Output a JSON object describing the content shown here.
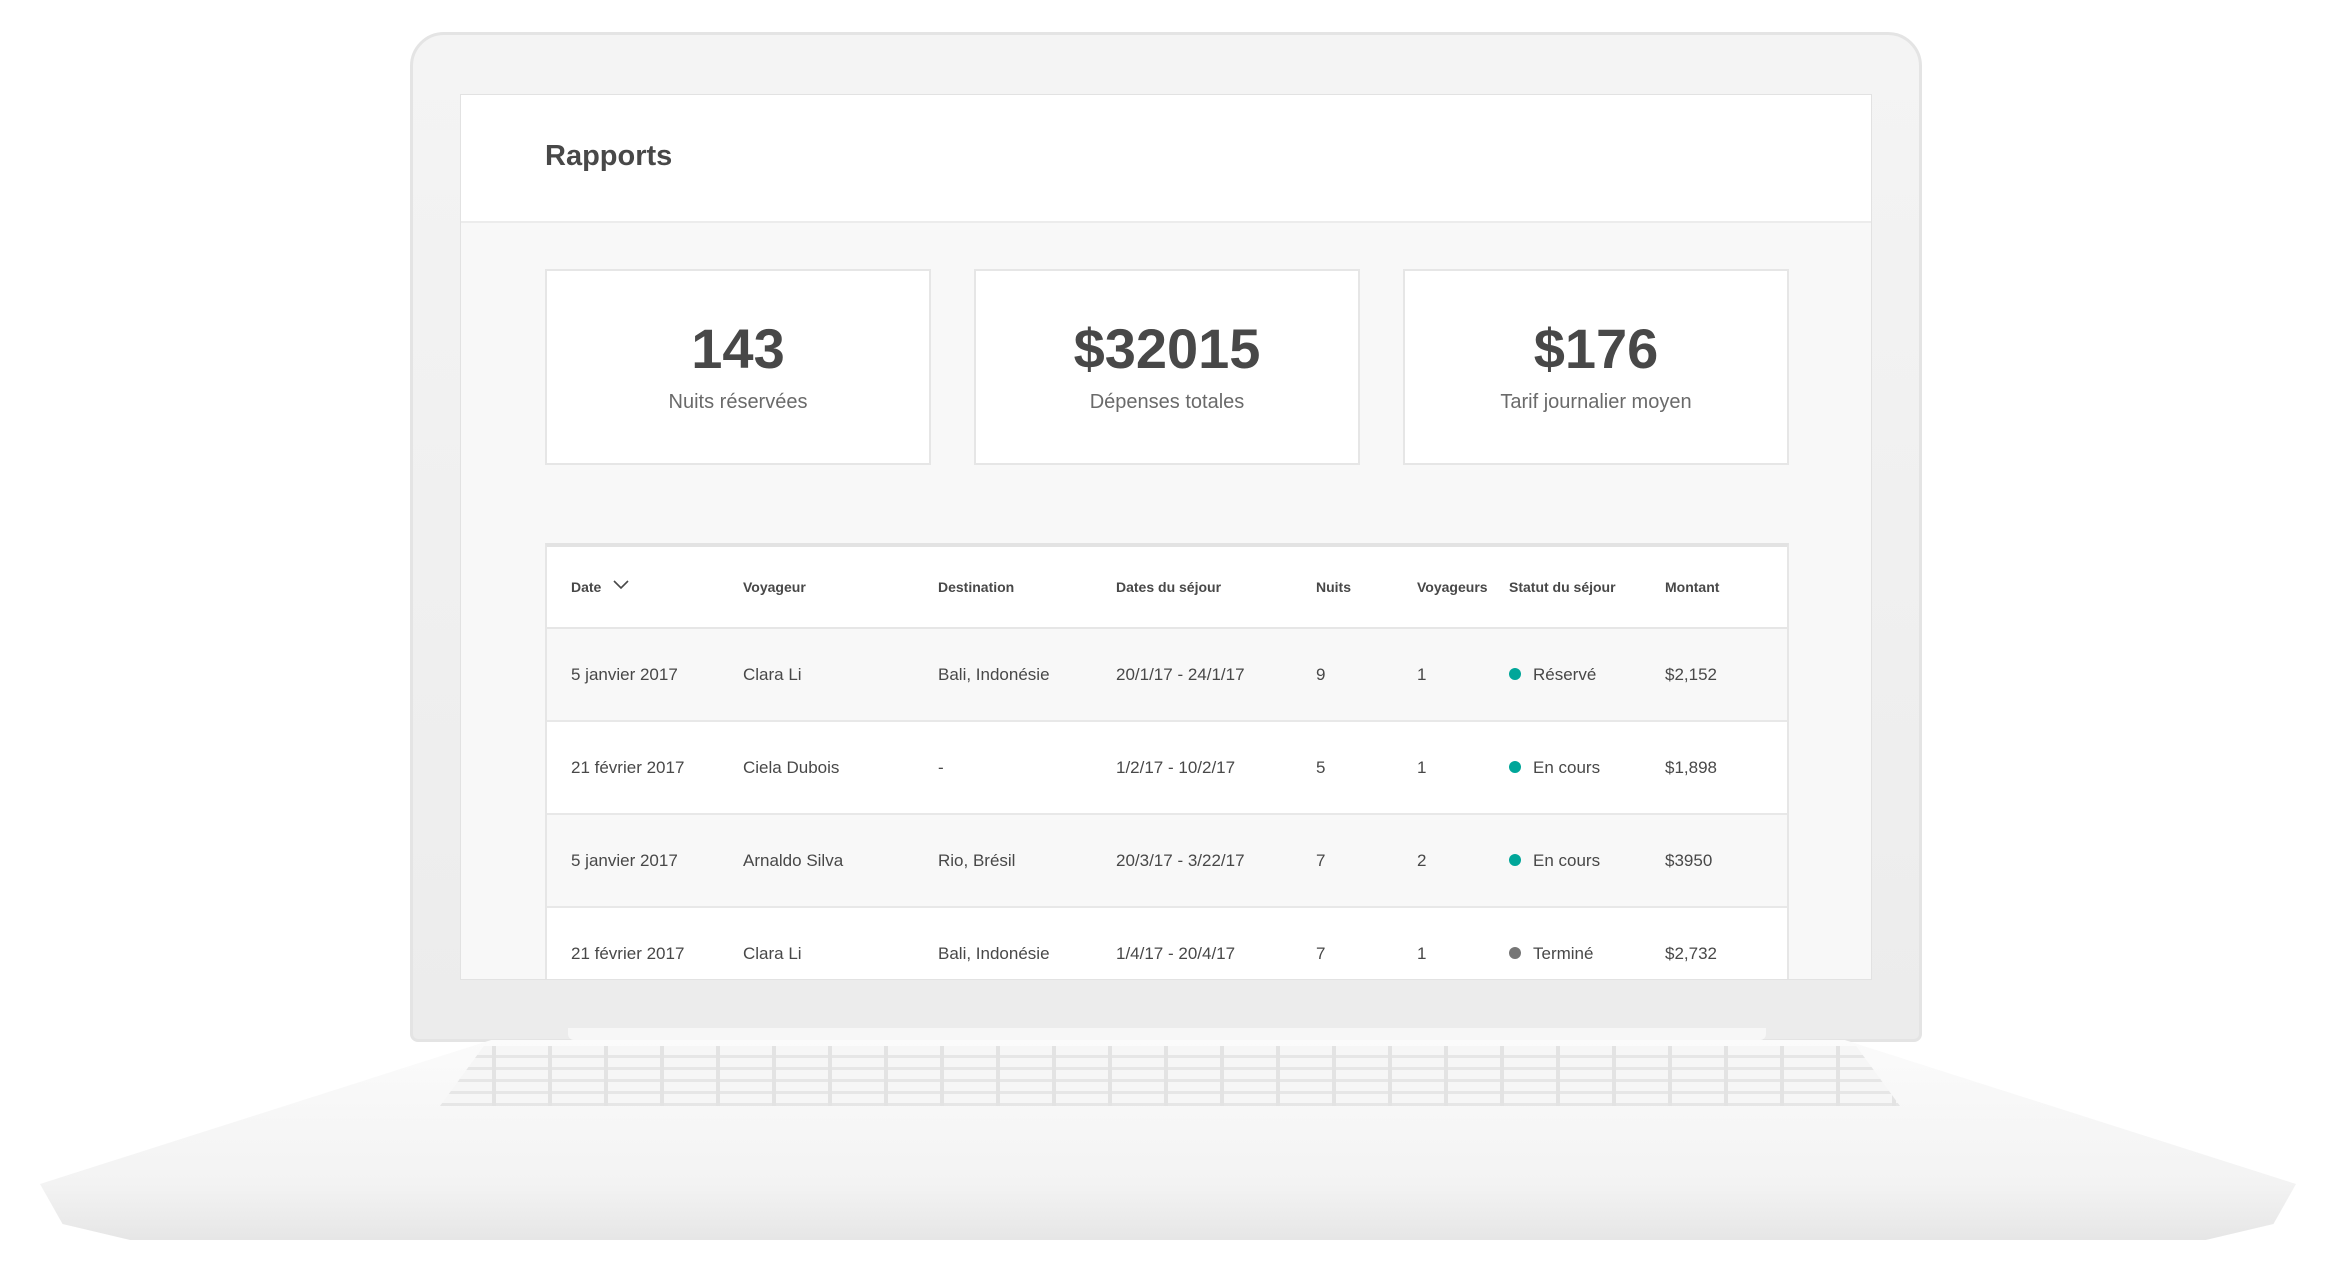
{
  "header": {
    "title": "Rapports"
  },
  "stats": [
    {
      "value": "143",
      "label": "Nuits réservées"
    },
    {
      "value": "$32015",
      "label": "Dépenses totales"
    },
    {
      "value": "$176",
      "label": "Tarif journalier moyen"
    }
  ],
  "table": {
    "columns": {
      "date": "Date",
      "voyageur": "Voyageur",
      "destination": "Destination",
      "dates": "Dates du séjour",
      "nuits": "Nuits",
      "voyageurs": "Voyageurs",
      "statut": "Statut du séjour",
      "montant": "Montant"
    },
    "sort_icon": "chevron-down-icon",
    "rows": [
      {
        "date": "5 janvier 2017",
        "voyageur": "Clara Li",
        "destination": "Bali, Indonésie",
        "dates": "20/1/17 - 24/1/17",
        "nuits": "9",
        "voyageurs": "1",
        "statut": "Réservé",
        "status_color": "#00a699",
        "montant": "$2,152"
      },
      {
        "date": "21 février 2017",
        "voyageur": "Ciela Dubois",
        "destination": "-",
        "dates": "1/2/17 - 10/2/17",
        "nuits": "5",
        "voyageurs": "1",
        "statut": "En cours",
        "status_color": "#00a699",
        "montant": "$1,898"
      },
      {
        "date": "5 janvier 2017",
        "voyageur": "Arnaldo Silva",
        "destination": "Rio, Brésil",
        "dates": "20/3/17 - 3/22/17",
        "nuits": "7",
        "voyageurs": "2",
        "statut": "En cours",
        "status_color": "#00a699",
        "montant": "$3950"
      },
      {
        "date": "21 février 2017",
        "voyageur": "Clara Li",
        "destination": "Bali, Indonésie",
        "dates": "1/4/17 - 20/4/17",
        "nuits": "7",
        "voyageurs": "1",
        "statut": "Terminé",
        "status_color": "#767676",
        "montant": "$2,732"
      }
    ]
  }
}
